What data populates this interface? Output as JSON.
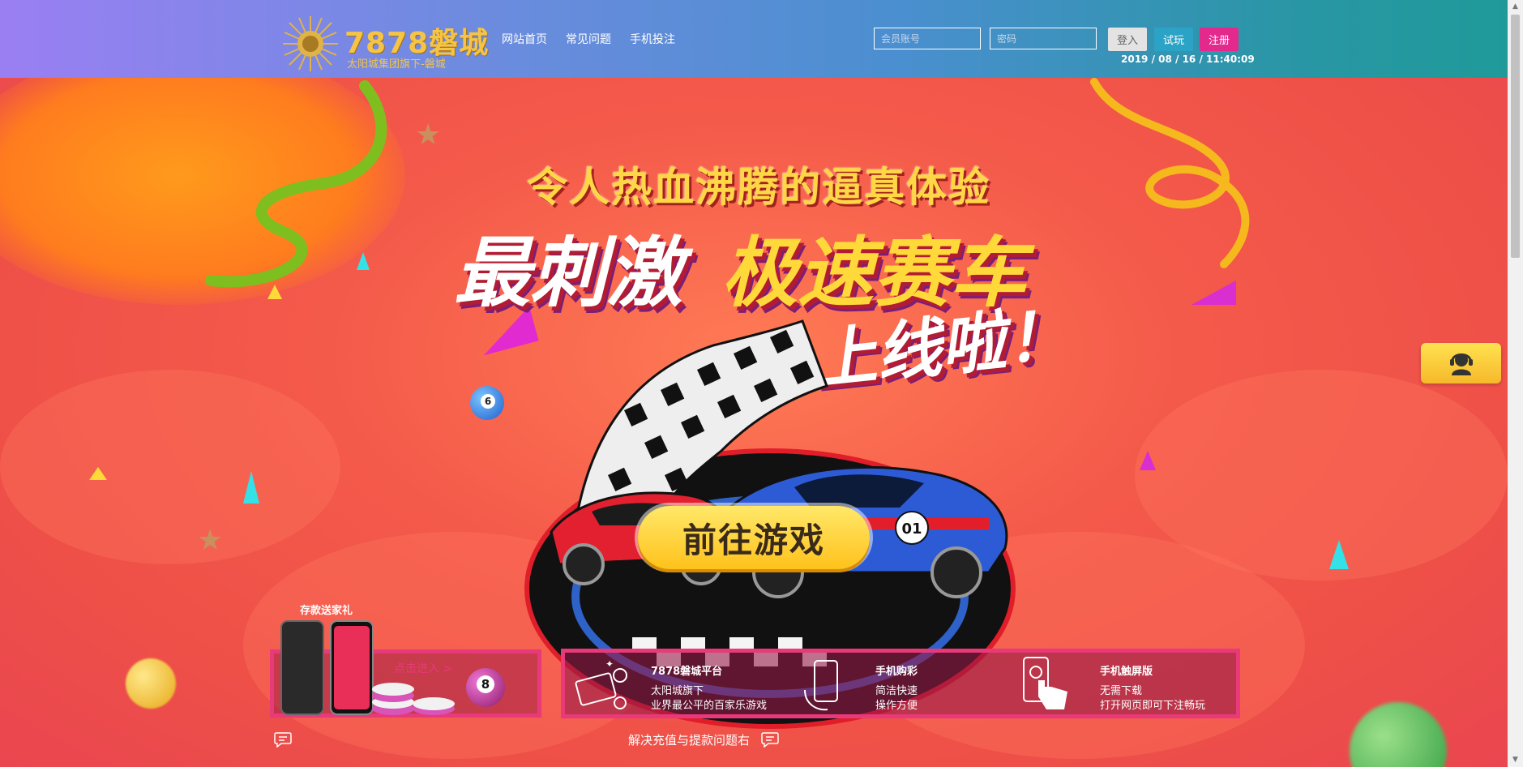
{
  "brand": {
    "logo_title": "7878磐城",
    "logo_subtitle": "太阳城集团旗下-磐城"
  },
  "nav": {
    "items": [
      {
        "label": "网站首页"
      },
      {
        "label": "常见问题"
      },
      {
        "label": "手机投注"
      }
    ]
  },
  "login": {
    "username_placeholder": "会员账号",
    "password_placeholder": "密码",
    "login_label": "登入",
    "trial_label": "试玩",
    "register_label": "注册",
    "datetime": "2019 / 08 / 16 / 11:40:09"
  },
  "banner": {
    "headline_top": "令人热血沸腾的逼真体验",
    "headline_main_1": "最刺激",
    "headline_main_2": "极速赛车",
    "headline_tail": "上线啦！",
    "cta_label": "前往游戏",
    "car_number": "01",
    "ball_number_1": "6",
    "ball_number_2": "8"
  },
  "promo": {
    "title": "存款送家礼",
    "link_label": "点击进入 >"
  },
  "features": [
    {
      "title": "7878磐城平台",
      "line1": "太阳城旗下",
      "line2": "业界最公平的百家乐游戏"
    },
    {
      "title": "手机购彩",
      "line1": "简洁快速",
      "line2": "操作方便"
    },
    {
      "title": "手机触屏版",
      "line1": "无需下载",
      "line2": "打开网页即可下注畅玩"
    }
  ],
  "footer": {
    "help_label": "解决充值与提款问题右"
  },
  "colors": {
    "accent_pink": "#e8397a",
    "gold": "#ffd645",
    "register": "#e4298d",
    "trial": "#2aa3c6"
  }
}
